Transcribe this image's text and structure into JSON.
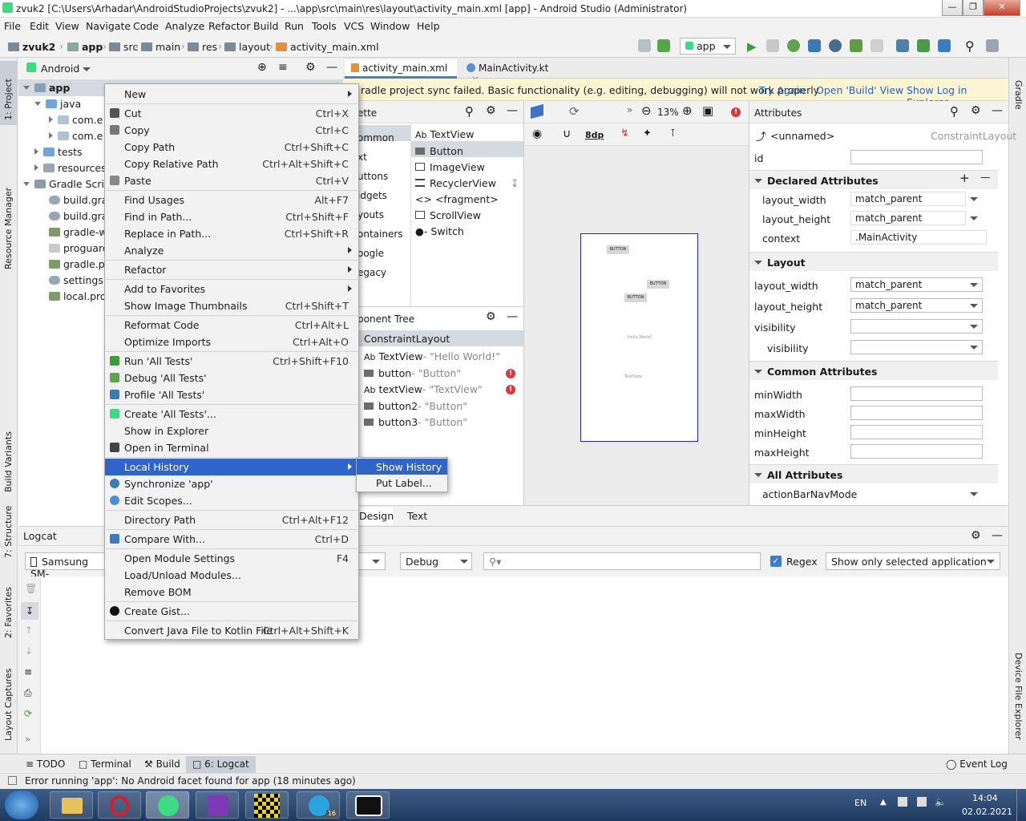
{
  "window": {
    "title": "zvuk2 [C:\\Users\\Arhadar\\AndroidStudioProjects\\zvuk2] - ...\\app\\src\\main\\res\\layout\\activity_main.xml [app] - Android Studio (Administrator)"
  },
  "menubar": [
    "File",
    "Edit",
    "View",
    "Navigate",
    "Code",
    "Analyze",
    "Refactor",
    "Build",
    "Run",
    "Tools",
    "VCS",
    "Window",
    "Help"
  ],
  "breadcrumb": [
    "zvuk2",
    "app",
    "src",
    "main",
    "res",
    "layout",
    "activity_main.xml"
  ],
  "run_config": "app",
  "project": {
    "view_mode": "Android",
    "tree": [
      "app",
      "java",
      "com.e",
      "com.e",
      "tests",
      "resources",
      "Gradle Scripts",
      "build.grad",
      "build.grad",
      "gradle-wr",
      "proguard-",
      "gradle.pro",
      "settings.g",
      "local.prop"
    ]
  },
  "side_tabs": {
    "project": "1: Project",
    "resource_manager": "Resource Manager",
    "build_variants": "Build Variants",
    "structure": "7: Structure",
    "favorites": "2: Favorites",
    "layout_captures": "Layout Captures",
    "gradle": "Gradle",
    "device_file_explorer": "Device File Explorer"
  },
  "editor_tabs": [
    "activity_main.xml",
    "MainActivity.kt"
  ],
  "sync_bar": {
    "message": "radle project sync failed. Basic functionality (e.g. editing, debugging) will not work properly.",
    "try_again": "Try Again",
    "open_build": "Open 'Build' View",
    "show_log": "Show Log in Explorer"
  },
  "palette": {
    "title": "ette",
    "categories": [
      "ommon",
      "xt",
      "uttons",
      "idgets",
      "youts",
      "ontainers",
      "oogle",
      "egacy"
    ],
    "items": [
      "TextView",
      "Button",
      "ImageView",
      "RecyclerView",
      "<fragment>",
      "ScrollView",
      "Switch"
    ]
  },
  "component_tree": {
    "title": "ponent Tree",
    "root": "ConstraintLayout",
    "rows": [
      {
        "name": "TextView",
        "desc": "- \"Hello World!\"",
        "error": false
      },
      {
        "name": "button",
        "desc": "- \"Button\"",
        "error": true
      },
      {
        "name": "textView",
        "desc": "- \"TextView\"",
        "error": true
      },
      {
        "name": "button2",
        "desc": "- \"Button\"",
        "error": false
      },
      {
        "name": "button3",
        "desc": "- \"Button\"",
        "error": false
      }
    ]
  },
  "canvas": {
    "zoom": "13%",
    "margin": "8dp",
    "button": "BUTTON",
    "hello": "Hello World!",
    "textview": "TextView"
  },
  "attributes": {
    "title": "Attributes",
    "component": "<unnamed>",
    "component_type": "ConstraintLayout",
    "id_label": "id",
    "declared": "Declared Attributes",
    "layout_width": "layout_width",
    "layout_height": "layout_height",
    "match_parent": "match_parent",
    "context": "context",
    "context_value": ".MainActivity",
    "layout": "Layout",
    "visibility": "visibility",
    "common": "Common Attributes",
    "minWidth": "minWidth",
    "maxWidth": "maxWidth",
    "minHeight": "minHeight",
    "maxHeight": "maxHeight",
    "all": "All Attributes",
    "actionBarNavMode": "actionBarNavMode"
  },
  "design_tabs": [
    "Design",
    "Text"
  ],
  "logcat": {
    "title": "Logcat",
    "device": "Samsung SM-",
    "level": "Debug",
    "regex": "Regex",
    "filter": "Show only selected application",
    "regex_checked": true
  },
  "bottom_tabs": [
    "TODO",
    "Terminal",
    "Build",
    "6: Logcat"
  ],
  "event_log": "Event Log",
  "status": "Error running 'app': No Android facet found for app (18 minutes ago)",
  "context_menu": [
    {
      "label": "New",
      "shortcut": "",
      "submenu": true
    },
    {
      "sep": true
    },
    {
      "label": "Cut",
      "shortcut": "Ctrl+X",
      "icon": "cut-icon"
    },
    {
      "label": "Copy",
      "shortcut": "Ctrl+C",
      "icon": "copy-icon"
    },
    {
      "label": "Copy Path",
      "shortcut": "Ctrl+Shift+C"
    },
    {
      "label": "Copy Relative Path",
      "shortcut": "Ctrl+Alt+Shift+C"
    },
    {
      "label": "Paste",
      "shortcut": "Ctrl+V",
      "icon": "paste-icon"
    },
    {
      "sep": true
    },
    {
      "label": "Find Usages",
      "shortcut": "Alt+F7"
    },
    {
      "label": "Find in Path...",
      "shortcut": "Ctrl+Shift+F"
    },
    {
      "label": "Replace in Path...",
      "shortcut": "Ctrl+Shift+R"
    },
    {
      "label": "Analyze",
      "shortcut": "",
      "submenu": true
    },
    {
      "sep": true
    },
    {
      "label": "Refactor",
      "shortcut": "",
      "submenu": true
    },
    {
      "sep": true
    },
    {
      "label": "Add to Favorites",
      "shortcut": "",
      "submenu": true
    },
    {
      "label": "Show Image Thumbnails",
      "shortcut": "Ctrl+Shift+T"
    },
    {
      "sep": true
    },
    {
      "label": "Reformat Code",
      "shortcut": "Ctrl+Alt+L"
    },
    {
      "label": "Optimize Imports",
      "shortcut": "Ctrl+Alt+O"
    },
    {
      "sep": true
    },
    {
      "label": "Run 'All Tests'",
      "shortcut": "Ctrl+Shift+F10",
      "icon": "run-icon"
    },
    {
      "label": "Debug 'All Tests'",
      "shortcut": "",
      "icon": "debug-icon"
    },
    {
      "label": "Profile 'All Tests'",
      "shortcut": "",
      "icon": "profile-icon"
    },
    {
      "sep": true
    },
    {
      "label": "Create 'All Tests'...",
      "shortcut": "",
      "icon": "android-icon"
    },
    {
      "label": "Show in Explorer",
      "shortcut": ""
    },
    {
      "label": "Open in Terminal",
      "shortcut": "",
      "icon": "terminal-icon"
    },
    {
      "sep": true
    },
    {
      "label": "Local History",
      "shortcut": "",
      "submenu": true,
      "highlight": true
    },
    {
      "label": "Synchronize 'app'",
      "shortcut": "",
      "icon": "sync-icon"
    },
    {
      "label": "Edit Scopes...",
      "shortcut": "",
      "icon": "scope-icon"
    },
    {
      "sep": true
    },
    {
      "label": "Directory Path",
      "shortcut": "Ctrl+Alt+F12"
    },
    {
      "sep": true
    },
    {
      "label": "Compare With...",
      "shortcut": "Ctrl+D",
      "icon": "compare-icon"
    },
    {
      "sep": true
    },
    {
      "label": "Open Module Settings",
      "shortcut": "F4"
    },
    {
      "label": "Load/Unload Modules...",
      "shortcut": ""
    },
    {
      "label": "Remove BOM",
      "shortcut": ""
    },
    {
      "sep": true
    },
    {
      "label": "Create Gist...",
      "shortcut": "",
      "icon": "github-icon"
    },
    {
      "sep": true
    },
    {
      "label": "Convert Java File to Kotlin File",
      "shortcut": "Ctrl+Alt+Shift+K"
    }
  ],
  "submenu": [
    "Show History",
    "Put Label..."
  ],
  "taskbar": {
    "lang": "EN",
    "time": "14:04",
    "date": "02.02.2021",
    "telegram_badge": "16"
  }
}
